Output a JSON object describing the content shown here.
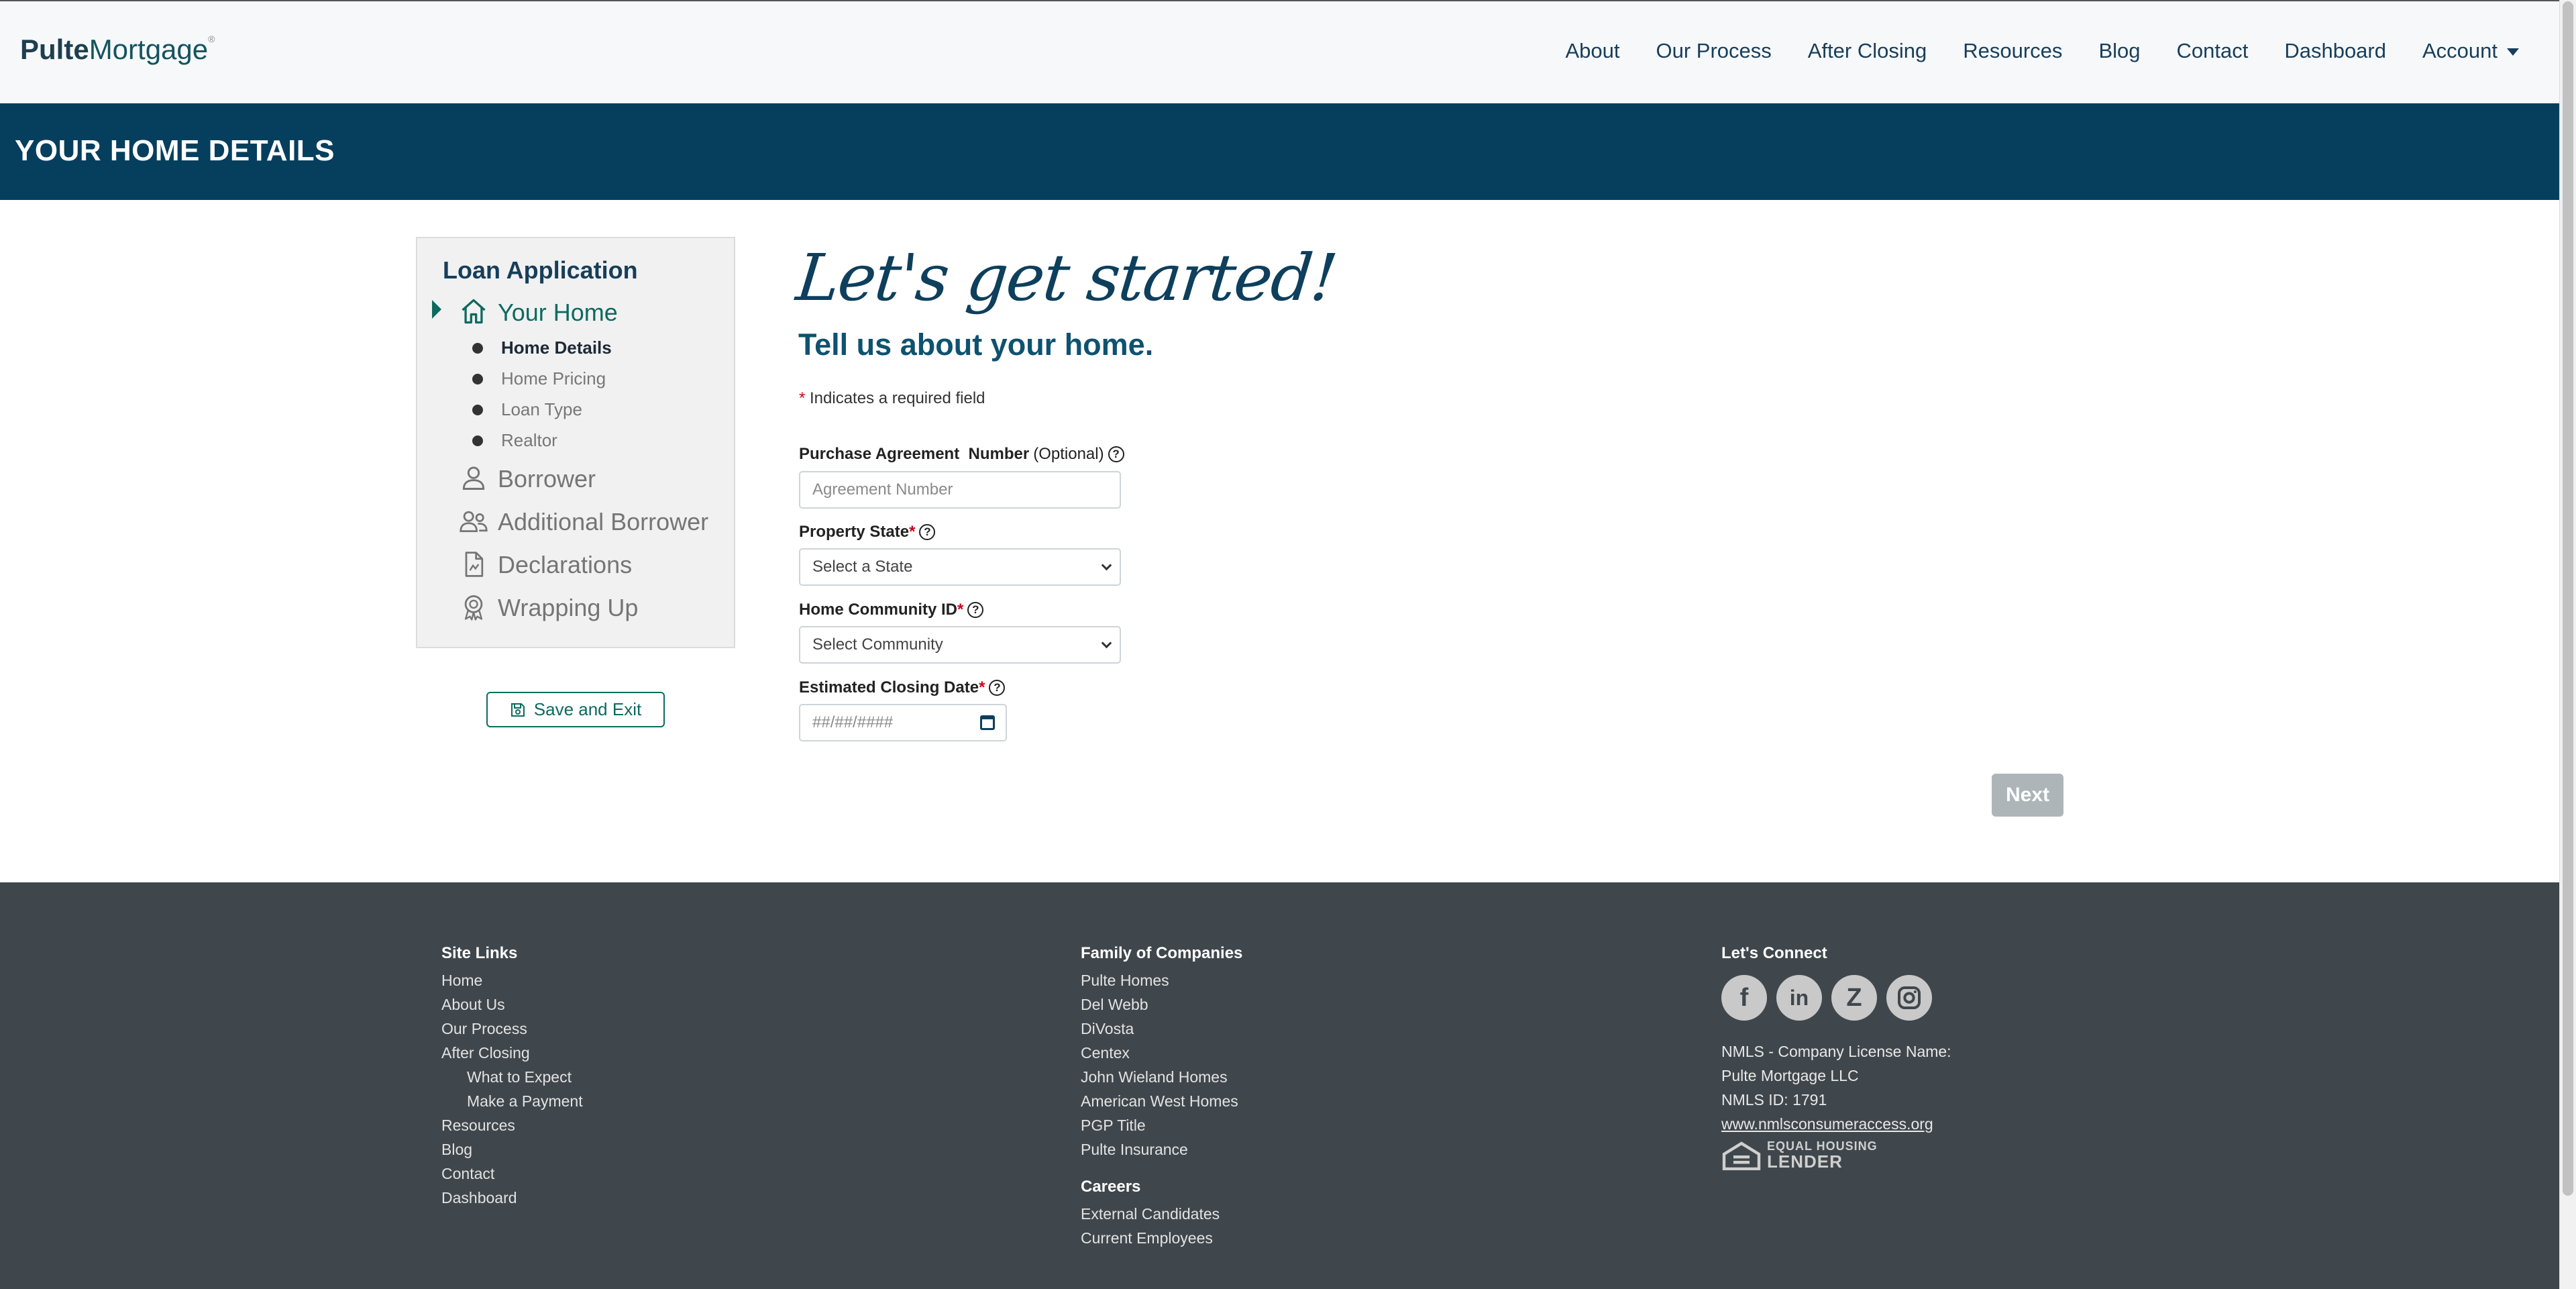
{
  "header": {
    "logo_bold": "Pulte",
    "logo_rest": "Mortgage",
    "nav": [
      "About",
      "Our Process",
      "After Closing",
      "Resources",
      "Blog",
      "Contact",
      "Dashboard",
      "Account"
    ]
  },
  "banner": {
    "title": "YOUR HOME DETAILS"
  },
  "sidebar": {
    "title": "Loan Application",
    "steps": [
      {
        "label": "Your Home",
        "icon": "home-icon",
        "active": true
      },
      {
        "label": "Borrower",
        "icon": "person-icon"
      },
      {
        "label": "Additional Borrower",
        "icon": "people-icon"
      },
      {
        "label": "Declarations",
        "icon": "document-icon"
      },
      {
        "label": "Wrapping Up",
        "icon": "award-icon"
      }
    ],
    "substeps": [
      "Home Details",
      "Home Pricing",
      "Loan Type",
      "Realtor"
    ],
    "save_label": "Save and Exit"
  },
  "form": {
    "script_heading": "Let's get started!",
    "subheading": "Tell us about your home.",
    "required_star": "*",
    "required_note": "Indicates a required field",
    "purchase_label": "Purchase Agreement  Number",
    "purchase_optional": "(Optional)",
    "purchase_placeholder": "Agreement Number",
    "state_label": "Property State",
    "state_value": "Select a State",
    "community_label": "Home Community ID",
    "community_value": "Select Community",
    "closing_label": "Estimated Closing Date",
    "closing_placeholder": "##/##/####",
    "help_glyph": "?",
    "next_label": "Next"
  },
  "footer": {
    "site_links": {
      "heading": "Site Links",
      "items": [
        "Home",
        "About Us",
        "Our Process",
        "After Closing",
        "What to Expect",
        "Make a Payment",
        "Resources",
        "Blog",
        "Contact",
        "Dashboard"
      ]
    },
    "family": {
      "heading": "Family of Companies",
      "items": [
        "Pulte Homes",
        "Del Webb",
        "DiVosta",
        "Centex",
        "John Wieland Homes",
        "American West Homes",
        "PGP Title",
        "Pulte Insurance"
      ]
    },
    "careers": {
      "heading": "Careers",
      "items": [
        "External Candidates",
        "Current Employees"
      ]
    },
    "connect": {
      "heading": "Let's Connect",
      "social": [
        "facebook-icon",
        "linkedin-icon",
        "zillow-icon",
        "instagram-icon"
      ],
      "nmls_line1": "NMLS - Company License Name:",
      "nmls_line2": "Pulte Mortgage LLC",
      "nmls_line3": "NMLS ID: 1791",
      "nmls_link": "www.nmlsconsumeraccess.org",
      "ehl_line1": "EQUAL HOUSING",
      "ehl_line2": "LENDER"
    }
  },
  "colors": {
    "banner": "#063f5e",
    "accent": "#0d6a60",
    "footer": "#40474c"
  }
}
